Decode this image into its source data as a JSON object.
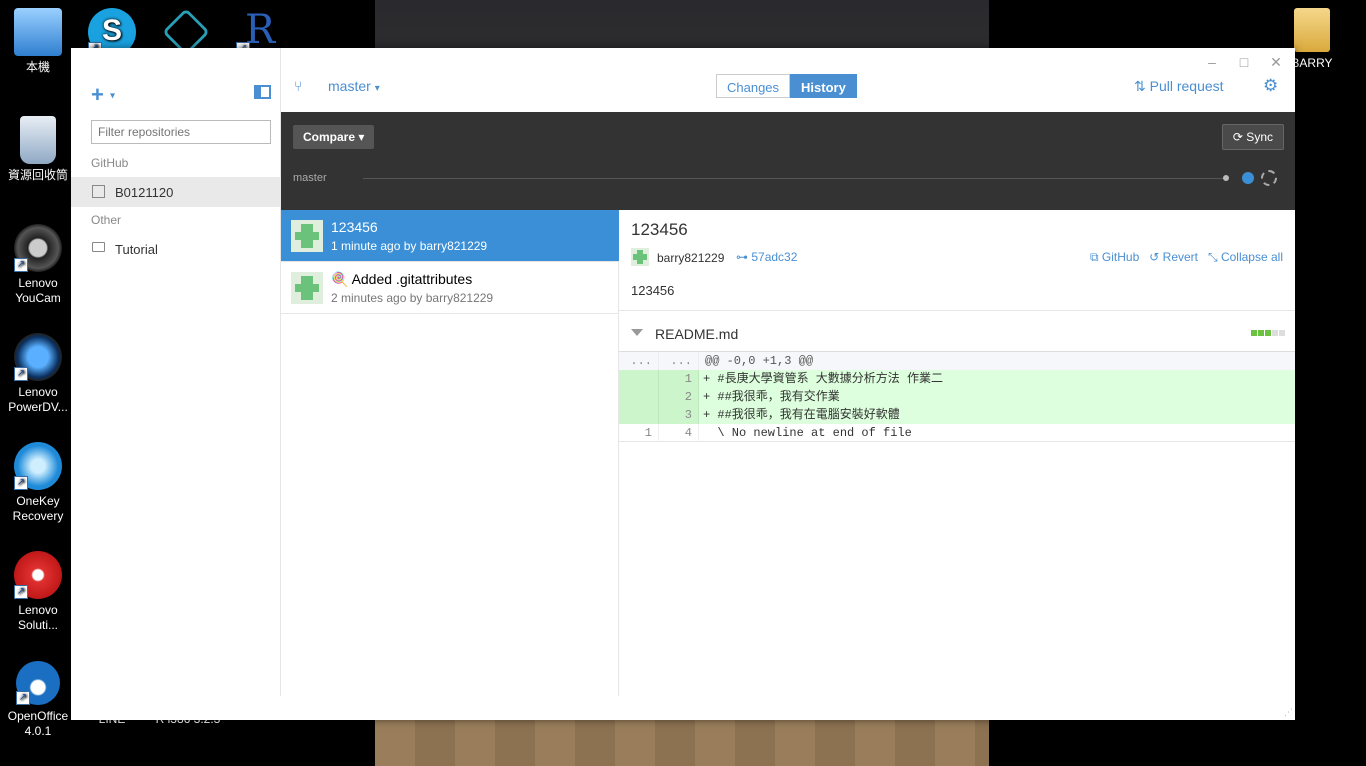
{
  "desktop": {
    "icons": [
      {
        "label": "本機"
      },
      {
        "label": "資源回收筒"
      },
      {
        "label": "Lenovo YouCam"
      },
      {
        "label": "Lenovo PowerDV..."
      },
      {
        "label": "OneKey Recovery"
      },
      {
        "label": "Lenovo Soluti..."
      },
      {
        "label": "OpenOffice 4.0.1"
      },
      {
        "label": "LINE"
      },
      {
        "label": "R i386 3.2.3"
      },
      {
        "label": "BARRY"
      }
    ]
  },
  "window": {
    "controls": {
      "minimize": "–",
      "maximize": "□",
      "close": "✕"
    }
  },
  "sidebar": {
    "add_label": "+",
    "add_caret": "▾",
    "filter_placeholder": "Filter repositories",
    "groups": [
      {
        "name": "GitHub",
        "repos": [
          {
            "name": "B0121120"
          }
        ]
      },
      {
        "name": "Other",
        "repos": [
          {
            "name": "Tutorial"
          }
        ]
      }
    ]
  },
  "topbar": {
    "branch": "master",
    "branch_caret": "▾",
    "tabs": [
      "Changes",
      "History"
    ],
    "active_tab": "History",
    "pull_request": "Pull request",
    "settings_icon": "gear-icon"
  },
  "toolbar": {
    "compare": "Compare ▾",
    "sync": "⟳ Sync",
    "timeline_branch": "master"
  },
  "commits": [
    {
      "title": "123456",
      "meta": "1 minute ago by barry821229",
      "selected": true
    },
    {
      "title": "Added .gitattributes",
      "meta": "2 minutes ago by barry821229",
      "selected": false
    }
  ],
  "detail": {
    "title": "123456",
    "author": "barry821229",
    "sha": "57adc32",
    "actions": [
      "GitHub",
      "Revert",
      "Collapse all"
    ],
    "message": "123456",
    "file": {
      "name": "README.md",
      "hunk_old": "...",
      "hunk_new": "...",
      "hunk": "@@ -0,0 +1,3 @@",
      "lines": [
        {
          "old": "",
          "new": "1",
          "text": "+ #長庚大學資管系 大數據分析方法 作業二",
          "type": "add"
        },
        {
          "old": "",
          "new": "2",
          "text": "+ ##我很乖，我有交作業",
          "type": "add"
        },
        {
          "old": "",
          "new": "3",
          "text": "+ ##我很乖，我有在電腦安裝好軟體",
          "type": "add"
        },
        {
          "old": "1",
          "new": "4",
          "text": "  \\ No newline at end of file",
          "type": "ctx"
        }
      ]
    }
  },
  "colors": {
    "accent": "#4a8fd2",
    "selected": "#3b8fd6",
    "diff_add": "#ddffdd"
  }
}
